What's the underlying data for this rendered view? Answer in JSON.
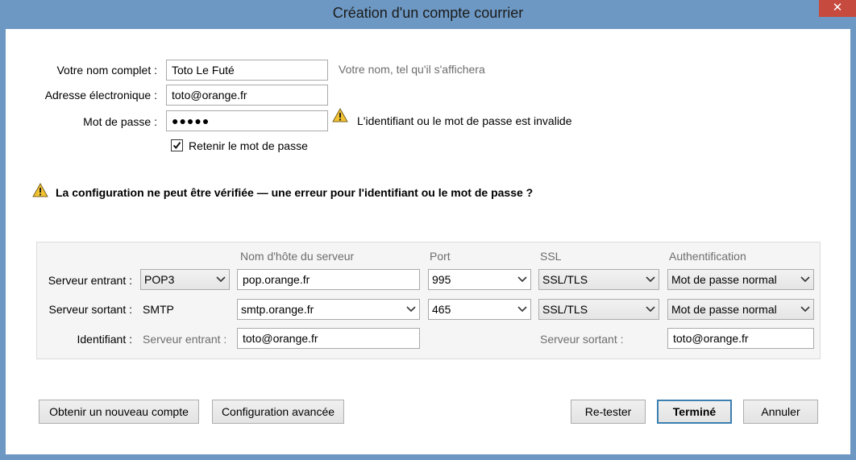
{
  "window": {
    "title": "Création d'un compte courrier",
    "close_glyph": "✕"
  },
  "identity": {
    "name_label": "Votre nom complet :",
    "name_value": "Toto Le Futé",
    "name_hint": "Votre nom, tel qu'il s'affichera",
    "email_label": "Adresse électronique :",
    "email_value": "toto@orange.fr",
    "password_label": "Mot de passe :",
    "password_value": "●●●●●",
    "password_error": "L'identifiant ou le mot de passe est invalide",
    "remember_label": "Retenir le mot de passe",
    "remember_checked": true
  },
  "status": {
    "message": "La configuration ne peut être vérifiée — une erreur pour l'identifiant ou le mot de passe ?"
  },
  "servers": {
    "columns": {
      "hostname": "Nom d'hôte du serveur",
      "port": "Port",
      "ssl": "SSL",
      "auth": "Authentification"
    },
    "incoming": {
      "label": "Serveur entrant :",
      "protocol": "POP3",
      "hostname": "pop.orange.fr",
      "port": "995",
      "ssl": "SSL/TLS",
      "auth": "Mot de passe normal"
    },
    "outgoing": {
      "label": "Serveur sortant :",
      "protocol": "SMTP",
      "hostname": "smtp.orange.fr",
      "port": "465",
      "ssl": "SSL/TLS",
      "auth": "Mot de passe normal"
    },
    "identifiers": {
      "label": "Identifiant :",
      "incoming_label": "Serveur entrant :",
      "incoming_value": "toto@orange.fr",
      "outgoing_label": "Serveur sortant :",
      "outgoing_value": "toto@orange.fr"
    }
  },
  "buttons": {
    "new_account": "Obtenir un nouveau compte",
    "advanced": "Configuration avancée",
    "retest": "Re-tester",
    "done": "Terminé",
    "cancel": "Annuler"
  },
  "colors": {
    "frame": "#6d98c3",
    "close": "#c74a3f",
    "warning": "#f2c230"
  },
  "icons": {
    "warning": "warning-icon",
    "dropdown": "chevron-down-icon",
    "check": "checkmark-icon"
  }
}
